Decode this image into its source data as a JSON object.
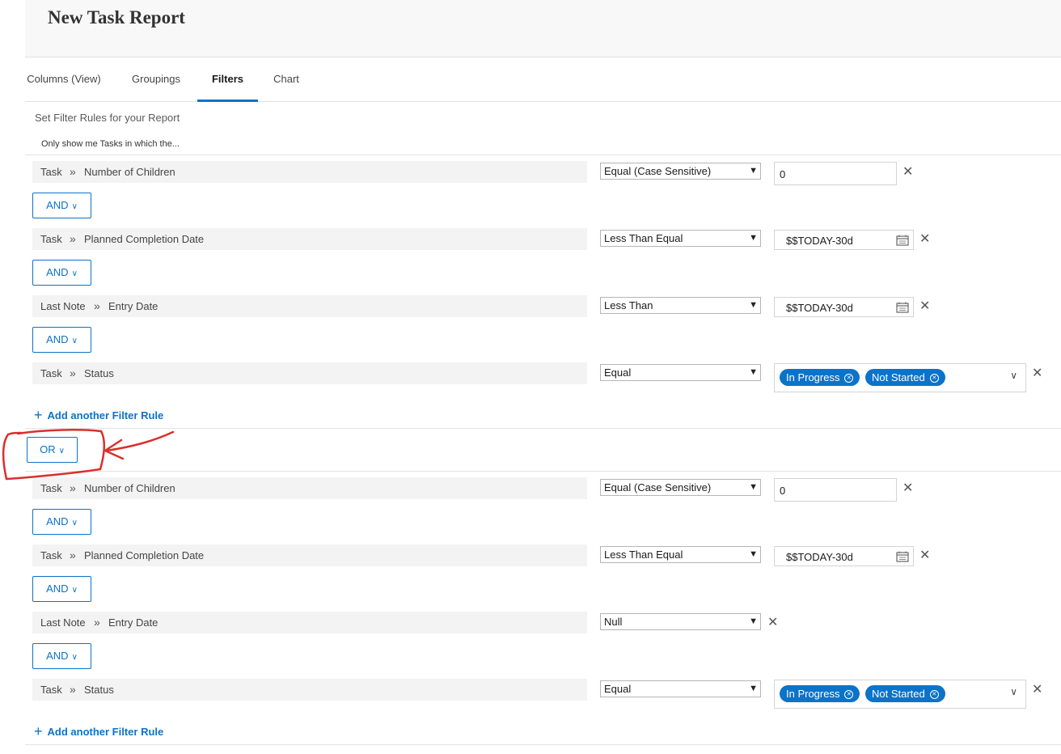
{
  "report": {
    "title": "New Task Report"
  },
  "tabs": [
    {
      "label": "Columns (View)"
    },
    {
      "label": "Groupings"
    },
    {
      "label": "Filters"
    },
    {
      "label": "Chart"
    }
  ],
  "filters": {
    "set_rules_label": "Set Filter Rules for your Report",
    "only_show_label": "Only show me Tasks in which the...",
    "separator": "»",
    "add_rule_label": "Add another Filter Rule",
    "and_label": "AND",
    "or_label": "OR",
    "groups": [
      {
        "rules": [
          {
            "object": "Task",
            "field": "Number of Children",
            "operator": "Equal (Case Sensitive)",
            "value": "0"
          },
          {
            "object": "Task",
            "field": "Planned Completion Date",
            "operator": "Less Than Equal",
            "value": "$$TODAY-30d"
          },
          {
            "object": "Last Note",
            "field": "Entry Date",
            "operator": "Less Than",
            "value": "$$TODAY-30d"
          },
          {
            "object": "Task",
            "field": "Status",
            "operator": "Equal",
            "chips": [
              "In Progress",
              "Not Started"
            ]
          }
        ]
      },
      {
        "rules": [
          {
            "object": "Task",
            "field": "Number of Children",
            "operator": "Equal (Case Sensitive)",
            "value": "0"
          },
          {
            "object": "Task",
            "field": "Planned Completion Date",
            "operator": "Less Than Equal",
            "value": "$$TODAY-30d"
          },
          {
            "object": "Last Note",
            "field": "Entry Date",
            "operator": "Null"
          },
          {
            "object": "Task",
            "field": "Status",
            "operator": "Equal",
            "chips": [
              "In Progress",
              "Not Started"
            ]
          }
        ]
      }
    ]
  },
  "colors": {
    "accent": "#0b73c9",
    "annotation": "#d9302c"
  },
  "icons": {
    "separator": "chevron-double-right-icon",
    "remove": "close-icon",
    "calendar": "calendar-icon",
    "dropdown": "chevron-down-icon",
    "add": "plus-icon"
  }
}
